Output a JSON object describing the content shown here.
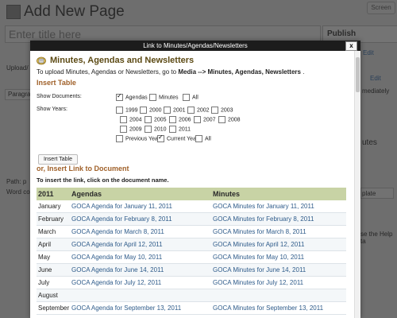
{
  "background": {
    "page_title": "Add New Page",
    "title_placeholder": "Enter title here",
    "screen_options": "Screen",
    "publish_label": "Publish",
    "upload_label": "Upload/",
    "paragraph_label": "Paragra",
    "path_label": "Path: p",
    "word_count_label": "Word co",
    "edit_label_1": "Edit",
    "edit_label_2": "Edit",
    "immediately_label": "mediately",
    "utes_label": "utes",
    "plate_label": "plate",
    "help_text": "se the Help ta"
  },
  "modal": {
    "title_bar": "Link to Minutes/Agendas/Newsletters",
    "close_label": "x",
    "heading": "Minutes, Agendas and Newsletters",
    "intro_prefix": "To upload Minutes, Agendas or Newsletters, go to",
    "intro_bold": "Media --> Minutes, Agendas, Newsletters",
    "intro_suffix": ".",
    "insert_table_heading": "Insert Table",
    "show_documents_label": "Show Documents:",
    "show_years_label": "Show Years:",
    "document_options": [
      {
        "label": "Agendas",
        "checked": true
      },
      {
        "label": "Minutes",
        "checked": false
      },
      {
        "label": "All",
        "checked": false
      }
    ],
    "year_rows": [
      [
        {
          "label": "1999",
          "checked": false
        },
        {
          "label": "2000",
          "checked": false
        },
        {
          "label": "2001",
          "checked": false
        },
        {
          "label": "2002",
          "checked": false
        },
        {
          "label": "2003",
          "checked": false
        }
      ],
      [
        {
          "label": "2004",
          "checked": false
        },
        {
          "label": "2005",
          "checked": false
        },
        {
          "label": "2006",
          "checked": false
        },
        {
          "label": "2007",
          "checked": false
        },
        {
          "label": "2008",
          "checked": false
        }
      ],
      [
        {
          "label": "2009",
          "checked": false
        },
        {
          "label": "2010",
          "checked": false
        },
        {
          "label": "2011",
          "checked": false
        }
      ],
      [
        {
          "label": "Previous Year",
          "checked": false
        },
        {
          "label": "Current Year",
          "checked": true
        },
        {
          "label": "All",
          "checked": false
        }
      ]
    ],
    "insert_table_button": "Insert Table",
    "insert_link_heading": "or, Insert Link to Document",
    "insert_link_instruction": "To insert the link, click on the document name.",
    "table": {
      "headers": [
        "2011",
        "Agendas",
        "Minutes"
      ],
      "rows": [
        [
          "January",
          "GOCA Agenda for January 11, 2011",
          "GOCA Minutes for January 11, 2011"
        ],
        [
          "February",
          "GOCA Agenda for February 8, 2011",
          "GOCA Minutes for February 8, 2011"
        ],
        [
          "March",
          "GOCA Agenda for March 8, 2011",
          "GOCA Minutes for March 8, 2011"
        ],
        [
          "April",
          "GOCA Agenda for April 12, 2011",
          "GOCA Minutes for April 12, 2011"
        ],
        [
          "May",
          "GOCA Agenda for May 10, 2011",
          "GOCA Minutes for May 10, 2011"
        ],
        [
          "June",
          "GOCA Agenda for June 14, 2011",
          "GOCA Minutes for June 14, 2011"
        ],
        [
          "July",
          "GOCA Agenda for July 12, 2011",
          "GOCA Minutes for July 12, 2011"
        ],
        [
          "August",
          "",
          ""
        ],
        [
          "September",
          "GOCA Agenda for September 13, 2011",
          "GOCA Minutes for September 13, 2011"
        ]
      ]
    }
  },
  "colors": {
    "heading": "#5c4a14",
    "section": "#a0612a",
    "table_header_bg": "#c8d3a5",
    "link": "#2e5b8a",
    "title_bar_bg": "#1c1c1c"
  }
}
